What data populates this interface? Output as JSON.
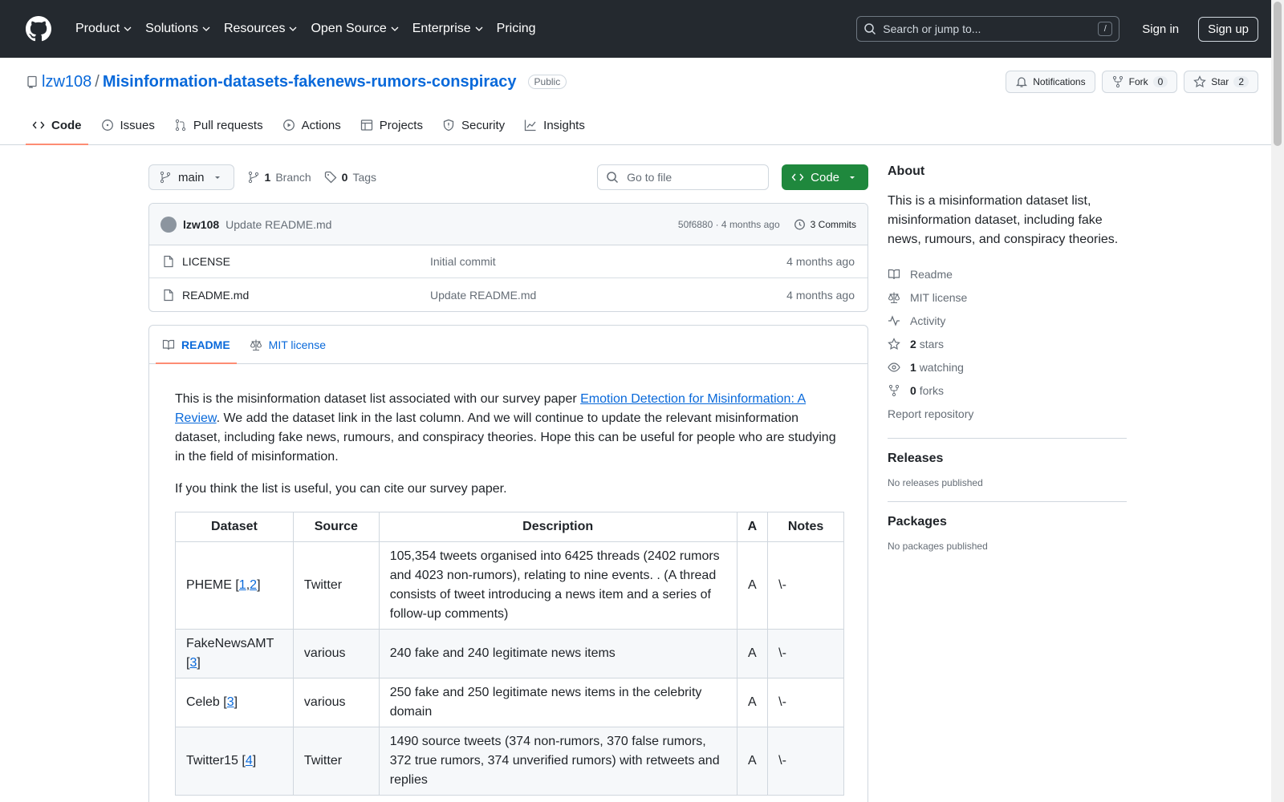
{
  "header": {
    "nav": [
      "Product",
      "Solutions",
      "Resources",
      "Open Source",
      "Enterprise",
      "Pricing"
    ],
    "search_placeholder": "Search or jump to...",
    "search_shortcut": "/",
    "signin": "Sign in",
    "signup": "Sign up"
  },
  "repo": {
    "owner": "lzw108",
    "separator": "/",
    "name": "Misinformation-datasets-fakenews-rumors-conspiracy",
    "visibility": "Public",
    "notifications": "Notifications",
    "fork_label": "Fork",
    "fork_count": "0",
    "star_label": "Star",
    "star_count": "2"
  },
  "tabs": [
    "Code",
    "Issues",
    "Pull requests",
    "Actions",
    "Projects",
    "Security",
    "Insights"
  ],
  "file_nav": {
    "branch": "main",
    "branch_count": "1",
    "branch_label": "Branch",
    "tag_count": "0",
    "tag_label": "Tags",
    "goto_placeholder": "Go to file",
    "code_button": "Code"
  },
  "commit": {
    "author": "lzw108",
    "message": "Update README.md",
    "meta": "50f6880 · 4 months ago",
    "commits": "3 Commits"
  },
  "files": [
    {
      "name": "LICENSE",
      "commit": "Initial commit",
      "age": "4 months ago"
    },
    {
      "name": "README.md",
      "commit": "Update README.md",
      "age": "4 months ago"
    }
  ],
  "readme": {
    "tab_readme": "README",
    "tab_license": "MIT license",
    "p1_before": "This is the misinformation dataset list associated with our survey paper ",
    "p1_link": "Emotion Detection for Misinformation: A Review",
    "p1_after": ". We add the dataset link in the last column. And we will continue to update the relevant misinformation dataset, including fake news, rumours, and conspiracy theories. Hope this can be useful for people who are studying in the field of misinformation.",
    "p2": "If you think the list is useful, you can cite our survey paper.",
    "table_headers": [
      "Dataset",
      "Source",
      "Description",
      "A",
      "Notes"
    ],
    "rows": [
      {
        "dataset": "PHEME [",
        "refs": [
          "1",
          "2"
        ],
        "close": "]",
        "source": "Twitter",
        "description": "105,354 tweets organised into 6425 threads (2402 rumors and 4023 non-rumors), relating to nine events. . (A thread consists of tweet introducing a news item and a series of follow-up comments)",
        "a": "A",
        "notes": "\\-"
      },
      {
        "dataset": "FakeNewsAMT [",
        "refs": [
          "3"
        ],
        "close": "]",
        "source": "various",
        "description": "240 fake and 240 legitimate news items",
        "a": "A",
        "notes": "\\-"
      },
      {
        "dataset": "Celeb [",
        "refs": [
          "3"
        ],
        "close": "]",
        "source": "various",
        "description": "250 fake and 250 legitimate news items in the celebrity domain",
        "a": "A",
        "notes": "\\-"
      },
      {
        "dataset": "Twitter15 [",
        "refs": [
          "4"
        ],
        "close": "]",
        "source": "Twitter",
        "description": "1490 source tweets (374 non-rumors, 370 false rumors, 372 true rumors, 374 unverified rumors) with retweets and replies",
        "a": "A",
        "notes": "\\-"
      }
    ]
  },
  "sidebar": {
    "about_title": "About",
    "about_desc": "This is a misinformation dataset list, misinformation dataset, including fake news, rumours, and conspiracy theories.",
    "readme": "Readme",
    "license": "MIT license",
    "activity": "Activity",
    "stars_count": "2",
    "stars_label": "stars",
    "watching_count": "1",
    "watching_label": "watching",
    "forks_count": "0",
    "forks_label": "forks",
    "report": "Report repository",
    "releases_title": "Releases",
    "releases_empty": "No releases published",
    "packages_title": "Packages",
    "packages_empty": "No packages published"
  }
}
